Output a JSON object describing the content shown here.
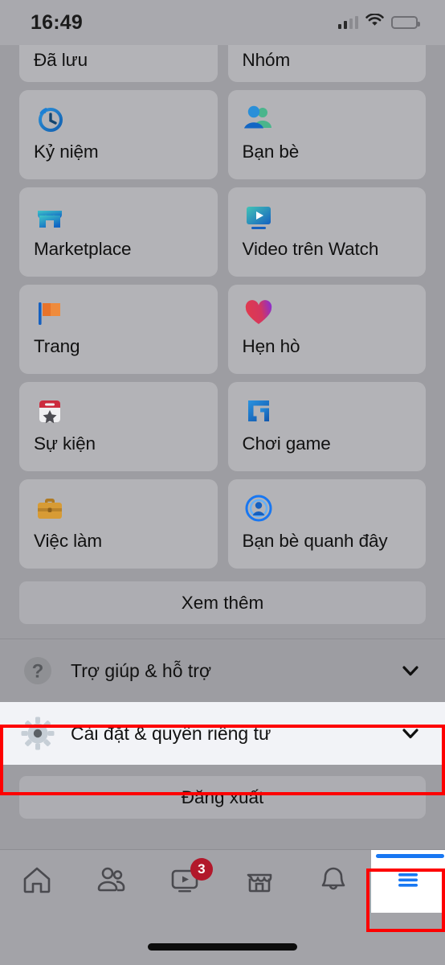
{
  "status_bar": {
    "time": "16:49",
    "cellular_icon": "cellular-signal-icon",
    "cellular_bars_filled": 2,
    "cellular_bars_total": 4,
    "wifi_icon": "wifi-icon",
    "battery_icon": "battery-low-icon",
    "battery_color": "#e8b930"
  },
  "menu": {
    "partial_row": [
      {
        "label": "Đã lưu",
        "icon": "saved-icon"
      },
      {
        "label": "Nhóm",
        "icon": "groups-icon"
      }
    ],
    "shortcuts": [
      {
        "label": "Kỷ niệm",
        "icon": "memories-clock-icon"
      },
      {
        "label": "Bạn bè",
        "icon": "friends-icon"
      },
      {
        "label": "Marketplace",
        "icon": "marketplace-storefront-icon"
      },
      {
        "label": "Video trên Watch",
        "icon": "watch-video-icon"
      },
      {
        "label": "Trang",
        "icon": "pages-flag-icon"
      },
      {
        "label": "Hẹn hò",
        "icon": "dating-heart-icon"
      },
      {
        "label": "Sự kiện",
        "icon": "events-calendar-icon"
      },
      {
        "label": "Chơi game",
        "icon": "gaming-g-icon"
      },
      {
        "label": "Việc làm",
        "icon": "jobs-briefcase-icon"
      },
      {
        "label": "Bạn bè quanh đây",
        "icon": "nearby-friends-icon"
      }
    ],
    "see_more_label": "Xem thêm",
    "expandable_rows": [
      {
        "label": "Trợ giúp & hỗ trợ",
        "icon": "help-question-icon",
        "chevron": "chevron-down-icon",
        "highlighted": false
      },
      {
        "label": "Cài đặt & quyền riêng tư",
        "icon": "settings-gear-icon",
        "chevron": "chevron-down-icon",
        "highlighted": true
      }
    ],
    "logout_label": "Đăng xuất"
  },
  "tabbar": {
    "tabs": [
      {
        "name": "home",
        "icon": "home-icon",
        "active": false,
        "badge": ""
      },
      {
        "name": "friends",
        "icon": "friends-tab-icon",
        "active": false,
        "badge": ""
      },
      {
        "name": "watch",
        "icon": "watch-tab-icon",
        "active": false,
        "badge": "3"
      },
      {
        "name": "marketplace",
        "icon": "marketplace-tab-icon",
        "active": false,
        "badge": ""
      },
      {
        "name": "notifications",
        "icon": "bell-icon",
        "active": false,
        "badge": ""
      },
      {
        "name": "menu",
        "icon": "hamburger-menu-icon",
        "active": true,
        "badge": ""
      }
    ]
  },
  "annotations": {
    "highlight_color": "#fe0000",
    "boxes": [
      {
        "target": "settings-privacy-row"
      },
      {
        "target": "menu-tab"
      }
    ]
  }
}
